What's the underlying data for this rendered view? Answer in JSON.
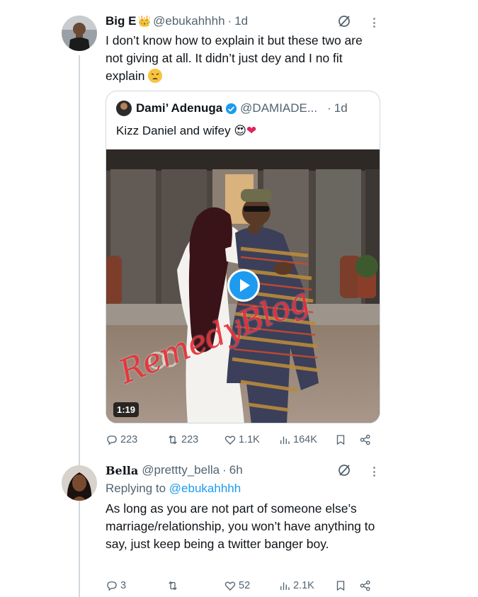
{
  "tweet1": {
    "display_name": "Big E",
    "crown_emoji": "👑",
    "handle": "@ebukahhhh",
    "age": "1d",
    "text": "I don’t know how to explain it but these two are not giving at all. It didn’t just dey and I no fit explain",
    "trailing_emoji": "weary-face",
    "quote": {
      "display_name": "Dami’ Adenuga",
      "handle": "@DAMIADE...",
      "age": "1d",
      "text": "Kizz Daniel and wifey",
      "emojis": [
        "😍",
        "❤"
      ],
      "video": {
        "duration": "1:19",
        "watermark": "RemedyBlog"
      }
    },
    "stats": {
      "replies": "223",
      "reposts": "223",
      "likes": "1.1K",
      "views": "164K"
    }
  },
  "tweet2": {
    "display_name": "Bella",
    "handle": "@prettty_bella",
    "age": "6h",
    "replying_prefix": "Replying to",
    "replying_to": "@ebukahhhh",
    "text": "As long as you are not part of someone else’s marriage/relationship, you won’t have anything to say, just keep being a twitter banger boy.",
    "stats": {
      "replies": "3",
      "reposts": "",
      "likes": "52",
      "views": "2.1K"
    }
  },
  "colors": {
    "accent": "#1d9bf0",
    "muted": "#536471",
    "text": "#0f1419",
    "border": "#cfd9de",
    "watermark": "#e61e28"
  }
}
